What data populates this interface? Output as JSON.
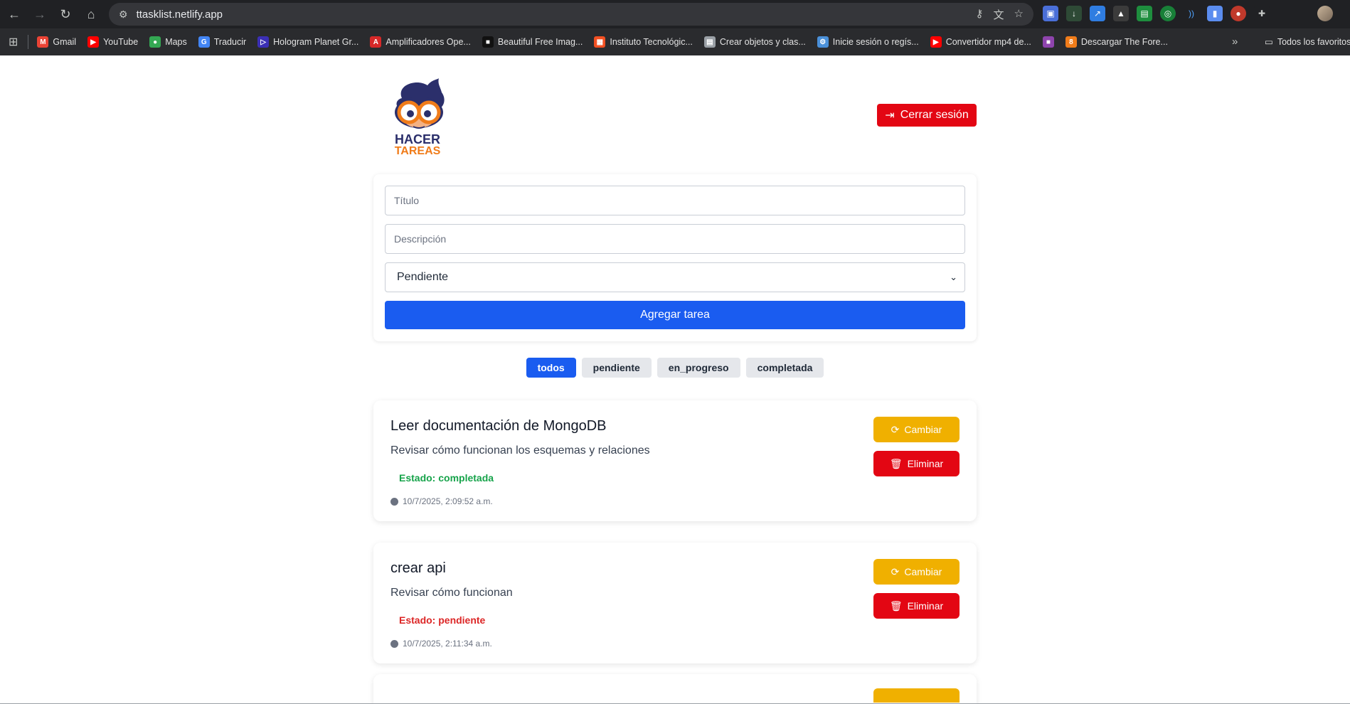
{
  "browser": {
    "url": "ttasklist.netlify.app",
    "bookmarks": [
      {
        "label": "Gmail",
        "icon": "gmail-icon",
        "color": "#ea4335",
        "glyph": "M"
      },
      {
        "label": "YouTube",
        "icon": "youtube-icon",
        "color": "#ff0000",
        "glyph": "▶"
      },
      {
        "label": "Maps",
        "icon": "maps-icon",
        "color": "#34a853",
        "glyph": "●"
      },
      {
        "label": "Traducir",
        "icon": "translate-icon",
        "color": "#4285f4",
        "glyph": "G"
      },
      {
        "label": "Hologram Planet Gr...",
        "icon": "hologram-icon",
        "color": "#3b2fb5",
        "glyph": "▷"
      },
      {
        "label": "Amplificadores Ope...",
        "icon": "amplifier-icon",
        "color": "#d62828",
        "glyph": "A"
      },
      {
        "label": "Beautiful Free Imag...",
        "icon": "unsplash-icon",
        "color": "#111111",
        "glyph": "■"
      },
      {
        "label": "Instituto Tecnológic...",
        "icon": "windows-icon",
        "color": "#f25022",
        "glyph": "▦"
      },
      {
        "label": "Crear objetos y clas...",
        "icon": "document-icon",
        "color": "#9aa0a6",
        "glyph": "▤"
      },
      {
        "label": "Inicie sesión o regís...",
        "icon": "login-icon",
        "color": "#4a90d9",
        "glyph": "⚙"
      },
      {
        "label": "Convertidor mp4 de...",
        "icon": "video-converter-icon",
        "color": "#ff0000",
        "glyph": "▶"
      },
      {
        "label": "",
        "icon": "colorful-icon",
        "color": "#8e44ad",
        "glyph": "■"
      },
      {
        "label": "Descargar The Fore...",
        "icon": "download-icon",
        "color": "#f07c1a",
        "glyph": "8"
      }
    ],
    "folder_label": "Todos los favoritos"
  },
  "app": {
    "logo_line1": "HACER",
    "logo_line2": "TAREAS",
    "logout_label": "Cerrar sesión",
    "form": {
      "title_placeholder": "Título",
      "description_placeholder": "Descripción",
      "status_selected": "Pendiente",
      "submit_label": "Agregar tarea"
    },
    "filters": [
      {
        "label": "todos",
        "active": true
      },
      {
        "label": "pendiente",
        "active": false
      },
      {
        "label": "en_progreso",
        "active": false
      },
      {
        "label": "completada",
        "active": false
      }
    ],
    "tasks": [
      {
        "title": "Leer documentación de MongoDB",
        "description": "Revisar cómo funcionan los esquemas y relaciones",
        "status": "Estado: completada",
        "status_type": "completed",
        "date": "10/7/2025, 2:09:52 a.m.",
        "change_label": "Cambiar",
        "delete_label": "Eliminar"
      },
      {
        "title": "crear api",
        "description": "Revisar cómo funcionan",
        "status": "Estado: pendiente",
        "status_type": "pending",
        "date": "10/7/2025, 2:11:34 a.m.",
        "change_label": "Cambiar",
        "delete_label": "Eliminar"
      }
    ]
  },
  "colors": {
    "primary": "#1a5cf0",
    "danger": "#e30613",
    "warning": "#f0b000",
    "success": "#16a34a"
  }
}
